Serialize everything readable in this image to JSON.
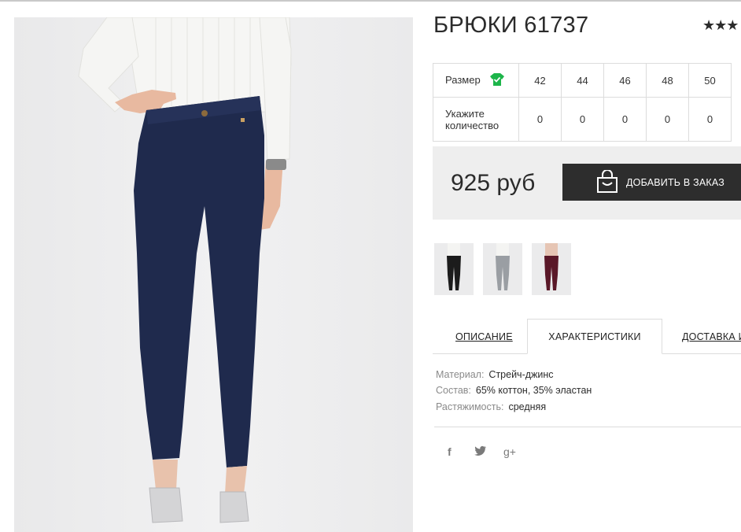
{
  "product": {
    "title": "БРЮКИ 61737",
    "rating_stars": "★★★",
    "price": "925 руб",
    "add_to_order_label": "ДОБАВИТЬ В ЗАКАЗ"
  },
  "size_table": {
    "size_label": "Размер",
    "quantity_label_line1": "Укажите",
    "quantity_label_line2": "количество",
    "sizes": [
      "42",
      "44",
      "46",
      "48",
      "50"
    ],
    "quantities": [
      "0",
      "0",
      "0",
      "0",
      "0"
    ]
  },
  "thumbnails": [
    {
      "color": "#1c1c1c",
      "name": "thumb-black"
    },
    {
      "color": "#9a9ea3",
      "name": "thumb-grey"
    },
    {
      "color": "#5a1828",
      "name": "thumb-burgundy"
    }
  ],
  "tabs": {
    "description": "ОПИСАНИЕ",
    "characteristics": "ХАРАКТЕРИСТИКИ",
    "delivery": "ДОСТАВКА И"
  },
  "specs": {
    "material_key": "Материал:",
    "material_val": "Стрейч-джинс",
    "composition_key": "Состав:",
    "composition_val": "65% коттон, 35% эластан",
    "stretch_key": "Растяжимость:",
    "stretch_val": "средняя"
  },
  "social": {
    "facebook": "f",
    "twitter": "🐦",
    "gplus": "g+"
  },
  "colors": {
    "pants_main": "#1f2a4d",
    "button_bg": "#2d2d2d",
    "tshirt_icon": "#1db54a"
  }
}
